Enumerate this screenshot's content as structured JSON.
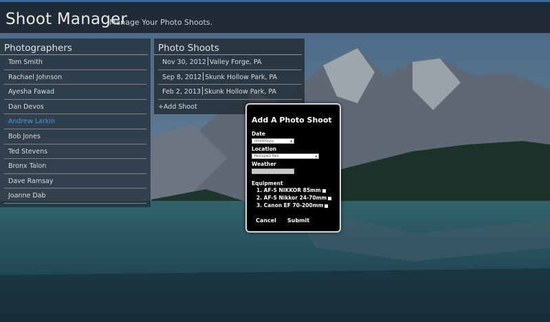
{
  "header": {
    "title": "Shoot Manager",
    "subtitle": "Manage Your Photo Shoots."
  },
  "photographers": {
    "title": "Photographers",
    "items": [
      {
        "label": "Tom Smith"
      },
      {
        "label": "Rachael Johnson"
      },
      {
        "label": "Ayesha Fawad"
      },
      {
        "label": "Dan Devos"
      },
      {
        "label": "Andrew Larkin"
      },
      {
        "label": "Bob Jones"
      },
      {
        "label": "Ted Stevens"
      },
      {
        "label": "Bronx Talon"
      },
      {
        "label": "Dave Ramsay"
      },
      {
        "label": "Joanne Dab"
      }
    ],
    "selected_index": 4,
    "selected_color": "#4f93d6"
  },
  "shoots": {
    "title": "Photo Shoots",
    "items": [
      {
        "date": "Nov 30, 2012",
        "place": "Valley Forge, PA"
      },
      {
        "date": "Sep 8, 2012",
        "place": "Skunk Hollow Park, PA"
      },
      {
        "date": "Feb 2, 2013",
        "place": "Skunk Hollow Park, PA"
      }
    ],
    "add_label": "+Add Shoot"
  },
  "modal": {
    "title": "Add A Photo Shoot",
    "date_label": "Date",
    "date_placeholder": "mm/dd/yyyy",
    "location_label": "Location",
    "location_value": "Pennypack Park",
    "weather_label": "Weather",
    "weather_value": "",
    "equipment_label": "Equipment",
    "equipment": [
      {
        "label": "1.  AF-S NIKKOR 85mm"
      },
      {
        "label": "2.  AF-S Nikkor 24-70mm"
      },
      {
        "label": "3.  Canon EF 70-200mm"
      }
    ],
    "cancel_label": "Cancel",
    "submit_label": "Submit"
  },
  "icons": {
    "dropdown": "chevron-down-icon",
    "checkbox": "checkbox-icon"
  }
}
